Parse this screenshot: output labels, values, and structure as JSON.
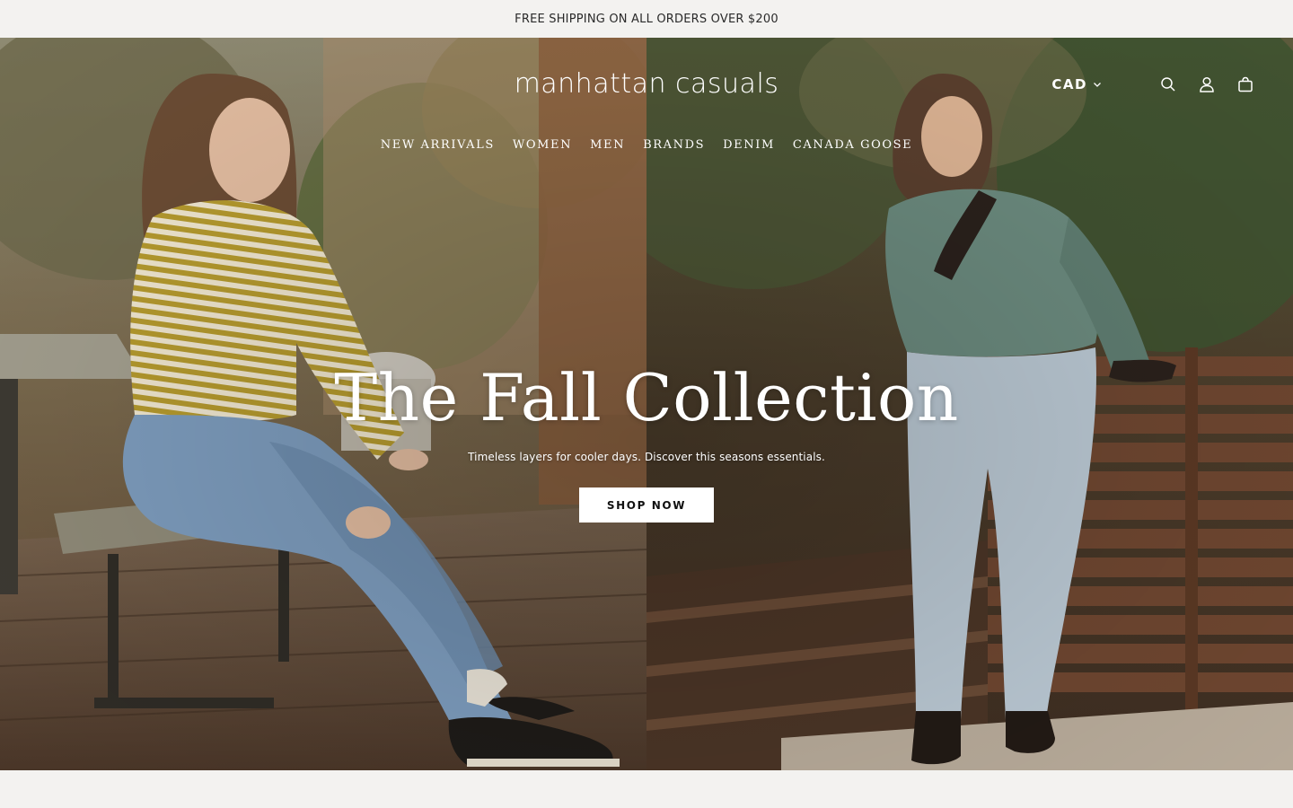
{
  "announcement": {
    "text": "FREE SHIPPING ON ALL ORDERS OVER $200"
  },
  "header": {
    "logo_text": "manhattan casuals",
    "currency": "CAD",
    "icons": [
      "search-icon",
      "account-icon",
      "cart-icon"
    ]
  },
  "nav": {
    "items": [
      {
        "label": "NEW ARRIVALS"
      },
      {
        "label": "WOMEN"
      },
      {
        "label": "MEN"
      },
      {
        "label": "BRANDS"
      },
      {
        "label": "DENIM"
      },
      {
        "label": "CANADA GOOSE"
      }
    ]
  },
  "hero": {
    "title": "The Fall Collection",
    "subtitle": "Timeless layers for cooler days. Discover this seasons essentials.",
    "cta_label": "SHOP NOW"
  },
  "colors": {
    "announcement_bg": "#f3f2f0",
    "text_dark": "#2a2a2a",
    "cta_bg": "#ffffff",
    "cta_text": "#111111",
    "overlay_text": "#ffffff"
  }
}
